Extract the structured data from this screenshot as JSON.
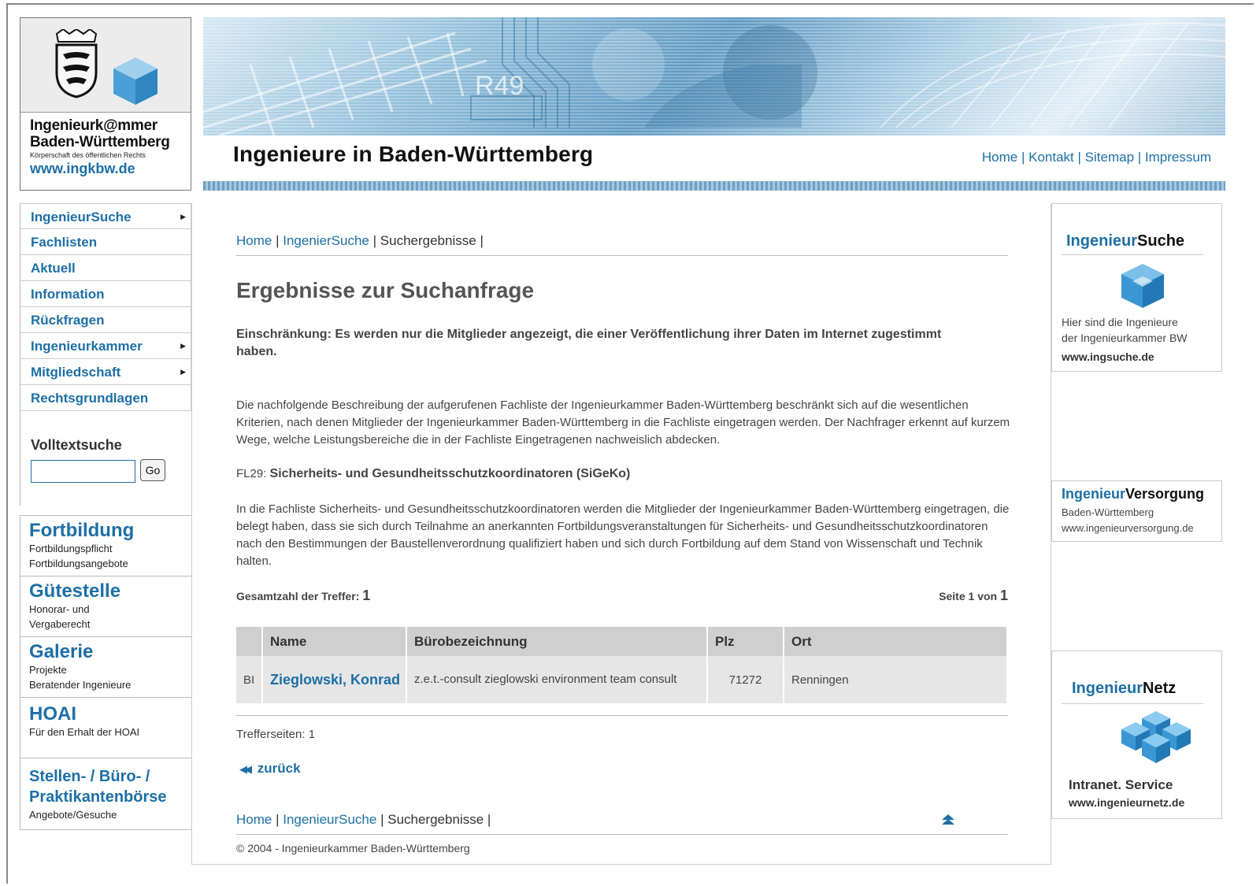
{
  "logo": {
    "name_line1": "Ingenieurk@mmer",
    "name_line2": "Baden-Württemberg",
    "sub": "Körperschaft des öffentlichen Rechts",
    "url": "www.ingkbw.de"
  },
  "banner": {
    "title": "Ingenieure in Baden-Württemberg",
    "links": [
      "Home",
      "Kontakt",
      "Sitemap",
      "Impressum"
    ]
  },
  "nav": {
    "items": [
      {
        "label": "IngenieurSuche",
        "submenu": true
      },
      {
        "label": "Fachlisten",
        "submenu": false
      },
      {
        "label": "Aktuell",
        "submenu": false
      },
      {
        "label": "Information",
        "submenu": false
      },
      {
        "label": "Rückfragen",
        "submenu": false
      },
      {
        "label": "Ingenieurkammer",
        "submenu": true
      },
      {
        "label": "Mitgliedschaft",
        "submenu": true
      },
      {
        "label": "Rechtsgrundlagen",
        "submenu": false
      }
    ],
    "arrow": "▶"
  },
  "search": {
    "label": "Volltextsuche",
    "value": "",
    "button": "Go"
  },
  "promos": [
    {
      "title": "Fortbildung",
      "lines": [
        "Fortbildungspflicht",
        "Fortbildungsangebote"
      ]
    },
    {
      "title": "Gütestelle",
      "lines": [
        "Honorar- und",
        "Vergaberecht"
      ]
    },
    {
      "title": "Galerie",
      "lines": [
        "Projekte",
        "Beratender Ingenieure"
      ]
    },
    {
      "title": "HOAI",
      "lines": [
        "Für den Erhalt der HOAI"
      ]
    },
    {
      "title_line1": "Stellen- / Büro- /",
      "title_line2": "Praktikantenbörse",
      "lines": [
        "Angebote/Gesuche"
      ]
    }
  ],
  "breadcrumb": {
    "home": "Home",
    "suche": "IngenierSuche",
    "current": "Suchergebnisse",
    "sep": "|"
  },
  "main": {
    "title": "Ergebnisse zur Suchanfrage",
    "restriction": "Einschränkung: Es werden nur die Mitglieder angezeigt, die einer Veröffentlichung ihrer Daten im Internet zugestimmt haben.",
    "description": "Die nachfolgende Beschreibung der aufgerufenen Fachliste der Ingenieurkammer Baden-Württemberg beschränkt sich auf die wesentlichen Kriterien, nach denen Mitglieder der Ingenieurkammer Baden-Württemberg in die Fachliste eingetragen werden. Der Nachfrager erkennt auf kurzem Wege, welche Leistungsbereiche die in der Fachliste Eingetragenen nachweislich abdecken.",
    "fl_code": "FL29:",
    "fl_name": "Sicherheits- und Gesundheitsschutzkoordinatoren (SiGeKo)",
    "fl_text": "In die Fachliste Sicherheits- und Gesundheitsschutzkoordinatoren werden die Mitglieder der Ingenieurkammer Baden-Württemberg eingetragen, die belegt haben, dass sie sich durch Teilnahme an anerkannten Fortbildungsveranstaltungen für Sicherheits- und Gesundheitsschutzkoordinatoren nach den Bestimmungen der Baustellenverordnung qualifiziert haben und sich durch Fortbildung auf dem Stand von Wissenschaft und Technik halten.",
    "total_label": "Gesamtzahl der Treffer:",
    "total_value": "1",
    "page_label": "Seite 1 von",
    "page_total": "1"
  },
  "table": {
    "headers": [
      "",
      "Name",
      "Bürobezeichnung",
      "Plz",
      "Ort"
    ],
    "rows": [
      {
        "type": "BI",
        "name": "Zieglowski, Konrad",
        "buero": "z.e.t.-consult zieglowski environment team consult",
        "plz": "71272",
        "ort": "Renningen"
      }
    ]
  },
  "footer": {
    "pages_label": "Trefferseiten:",
    "pages_value": "1",
    "back": "zurück",
    "crumb_home": "Home",
    "crumb_suche": "IngenieurSuche",
    "crumb_current": "Suchergebnisse",
    "copyright": "© 2004 - Ingenieurkammer Baden-Württemberg"
  },
  "right": {
    "suche": {
      "title_a": "Ingenieur",
      "title_b": "Suche",
      "text1": "Hier sind die Ingenieure",
      "text2": "der Ingenieurkammer BW",
      "url": "www.ingsuche.de"
    },
    "versorgung": {
      "title_a": "Ingenieur",
      "title_b": "Versorgung",
      "text": "Baden-Württemberg",
      "url": "www.ingenieurversorgung.de"
    },
    "netz": {
      "title_a": "Ingenieur",
      "title_b": "Netz",
      "text": "Intranet. Service",
      "url": "www.ingenieurnetz.de"
    }
  },
  "colors": {
    "link": "#1d6fa5",
    "table_header": "#cfcfcf",
    "table_row": "#e6e6e6"
  }
}
